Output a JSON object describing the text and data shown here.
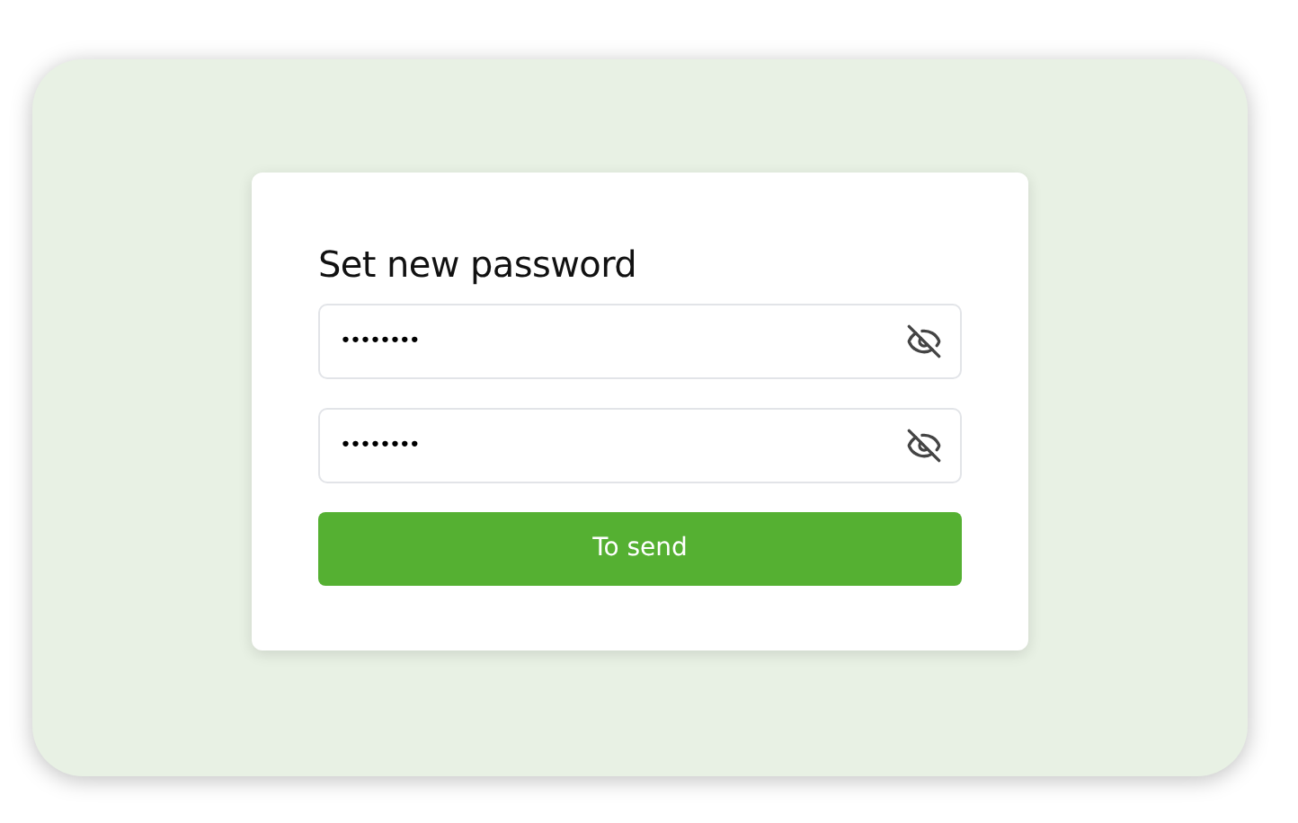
{
  "form": {
    "title": "Set new password",
    "fields": [
      {
        "value": "••••••••"
      },
      {
        "value": "••••••••"
      }
    ],
    "submit": "To send"
  }
}
